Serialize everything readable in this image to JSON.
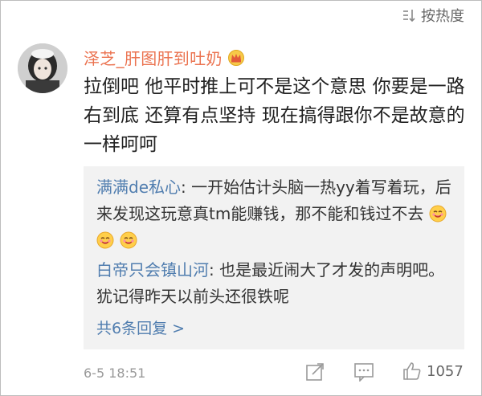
{
  "sort": {
    "label": "按热度",
    "icon": "sort-icon"
  },
  "comment": {
    "avatar": "user-avatar",
    "username": "泽芝_肝图肝到吐奶",
    "badge_icon": "crown-icon",
    "text": "拉倒吧 他平时推上可不是这个意思 你要是一路右到底 还算有点坚持 现在搞得跟你不是故意的一样呵呵",
    "time": "6-5 18:51",
    "likes": "1057"
  },
  "replies": [
    {
      "user": "满满de私心",
      "text": ": 一开始估计头脑一热yy着写着玩，后来发现这玩意真tm能赚钱，那不能和钱过不去",
      "emoji": [
        "drool-emoji",
        "drool-emoji",
        "drool-emoji"
      ]
    },
    {
      "user": "白帝只会镇山河",
      "text": ": 也是最近闹大了才发的声明吧。犹记得昨天以前头还很铁呢"
    }
  ],
  "more_replies": "共6条回复 >",
  "colors": {
    "username": "#eb7350",
    "link": "#507daf",
    "reply_bg": "#f2f2f2",
    "muted": "#999999"
  }
}
